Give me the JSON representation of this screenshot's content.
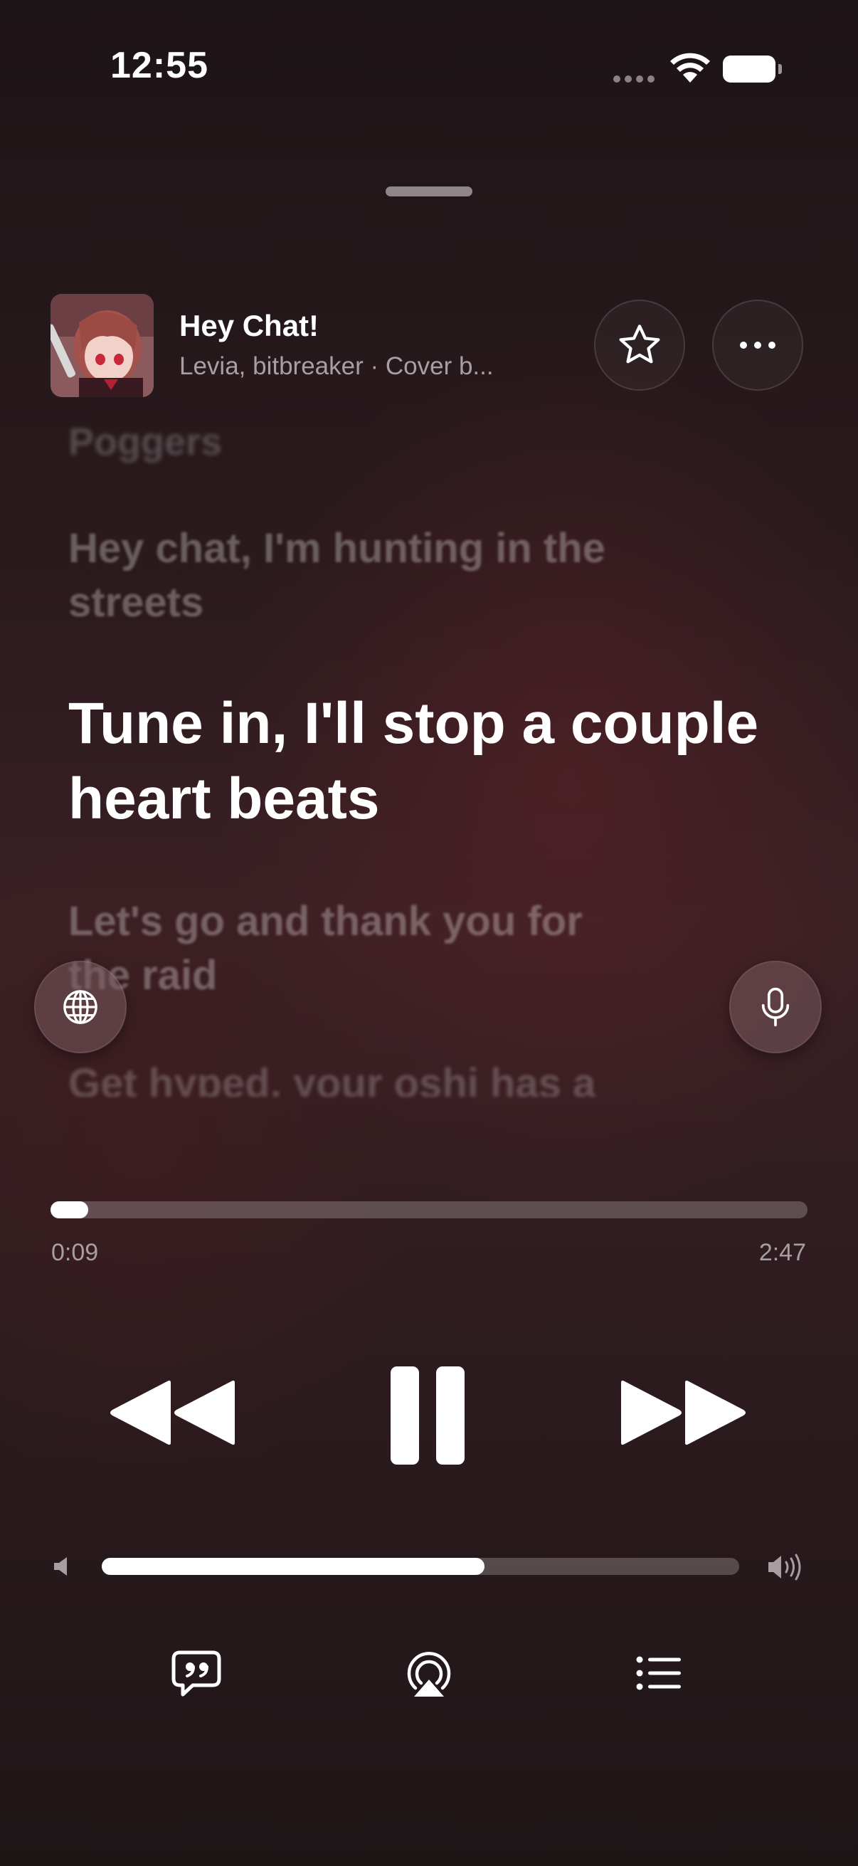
{
  "status_bar": {
    "time": "12:55"
  },
  "track": {
    "title": "Hey Chat!",
    "subtitle": "Levia, bitbreaker · Cover b..."
  },
  "lyrics": {
    "prev2": "Poggers",
    "prev1": "Hey chat, I'm hunting in the streets",
    "current": "Tune in, I'll stop a couple heart beats",
    "next1": "Let's go and thank you for the raid",
    "next2": "Get hyped, your oshi has a"
  },
  "playback": {
    "elapsed": "0:09",
    "total": "2:47",
    "progress_fraction": 0.05,
    "volume_fraction": 0.6,
    "is_playing": true
  },
  "icons": {
    "favorite": "star-icon",
    "more": "ellipsis-icon",
    "translate": "globe-icon",
    "sing": "microphone-icon",
    "rewind": "backward-icon",
    "pause": "pause-icon",
    "forward": "forward-icon",
    "volume_low": "speaker-low-icon",
    "volume_high": "speaker-high-icon",
    "lyrics": "quote-bubble-icon",
    "airplay": "airplay-icon",
    "queue": "list-icon"
  },
  "colors": {
    "background": "#2a1a1d",
    "accent": "#ffffff",
    "secondary_text": "#a99fa2"
  }
}
